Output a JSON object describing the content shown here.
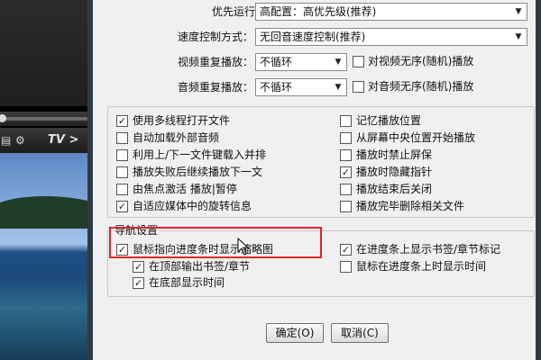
{
  "player": {
    "tv_label": "TV >",
    "icons": [
      "menu-icon",
      "gear-icon"
    ]
  },
  "priority": {
    "label": "优先运行权：",
    "value": "高配置：高优先级(推荐)"
  },
  "speed": {
    "label": "速度控制方式：",
    "value": "无回音速度控制(推荐)"
  },
  "video_repeat": {
    "label": "视频重复播放：",
    "value": "不循环",
    "random_label": "对视频无序(随机)播放",
    "random_checked": false
  },
  "audio_repeat": {
    "label": "音频重复播放：",
    "value": "不循环",
    "random_label": "对音频无序(随机)播放",
    "random_checked": false
  },
  "options_left": [
    {
      "label": "使用多线程打开文件",
      "checked": true
    },
    {
      "label": "自动加载外部音频",
      "checked": false
    },
    {
      "label": "利用上/下一文件键载入并排",
      "checked": false
    },
    {
      "label": "播放失败后继续播放下一文",
      "checked": false
    },
    {
      "label": "由焦点激活 播放|暂停",
      "checked": false
    },
    {
      "label": "自适应媒体中的旋转信息",
      "checked": true
    }
  ],
  "options_right": [
    {
      "label": "记忆播放位置",
      "checked": false
    },
    {
      "label": "从屏幕中央位置开始播放",
      "checked": false
    },
    {
      "label": "播放时禁止屏保",
      "checked": false
    },
    {
      "label": "播放时隐藏指针",
      "checked": true
    },
    {
      "label": "播放结束后关闭",
      "checked": false
    },
    {
      "label": "播放完毕删除相关文件",
      "checked": false
    }
  ],
  "nav": {
    "title": "导航设置",
    "left": [
      {
        "label": "鼠标指向进度条时显示缩略图",
        "checked": true
      },
      {
        "label": "在顶部输出书签/章节",
        "checked": true
      },
      {
        "label": "在底部显示时间",
        "checked": true
      }
    ],
    "right": [
      {
        "label": "在进度条上显示书签/章节标记",
        "checked": true
      },
      {
        "label": "鼠标在进度条上时显示时间",
        "checked": false
      }
    ]
  },
  "buttons": {
    "ok": "确定(O)",
    "cancel": "取消(C)"
  },
  "colors": {
    "highlight": "#e0242a",
    "frame": "#2f3a45"
  }
}
